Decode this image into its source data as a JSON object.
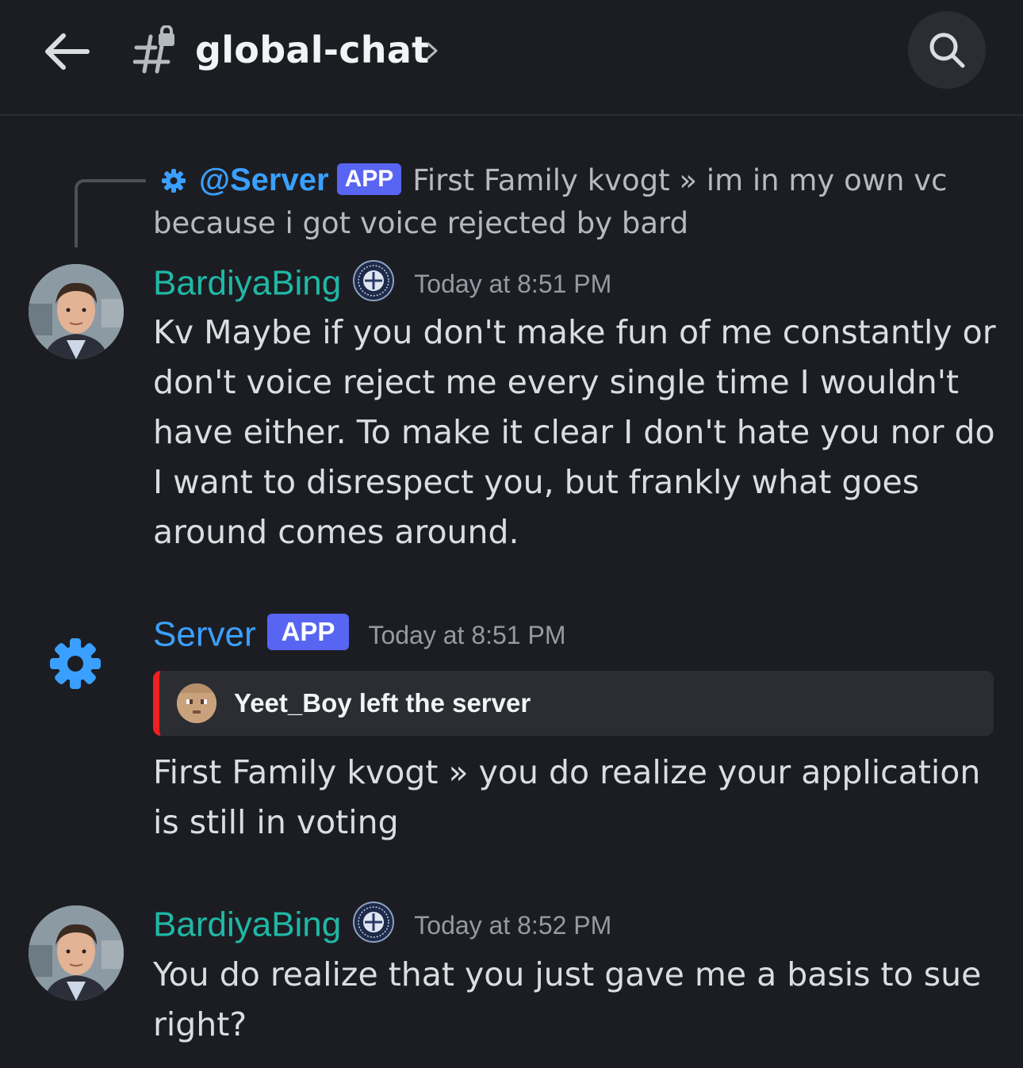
{
  "header": {
    "channel_name": "global-chat"
  },
  "reply_preview": {
    "mention": "@Server",
    "badge": "APP",
    "text": "First Family kvogt » im in my own vc because i got voice rejected by bard"
  },
  "messages": [
    {
      "username": "BardiyaBing",
      "timestamp": "Today at 8:51 PM",
      "text": "Kv Maybe if you don't make fun of me constantly or don't voice reject me every single time I wouldn't have either. To make it clear I don't hate you nor do I want to disrespect you, but frankly what goes around comes around."
    },
    {
      "username": "Server",
      "badge": "APP",
      "timestamp": "Today at 8:51 PM",
      "embed_text": "Yeet_Boy left the server",
      "text": "First Family kvogt » you do realize your application is still in voting"
    },
    {
      "username": "BardiyaBing",
      "timestamp": "Today at 8:52 PM",
      "text": "You do realize that you just gave me a basis to sue right?"
    }
  ],
  "colors": {
    "background": "#1c1d22",
    "username_teal": "#1fb8a6",
    "server_blue": "#3aa0ff",
    "app_badge": "#5865f2",
    "embed_accent": "#f02020"
  },
  "icons": {
    "back": "arrow-left-icon",
    "channel": "locked-hashtag-icon",
    "search": "search-icon",
    "bot": "gear-icon"
  }
}
